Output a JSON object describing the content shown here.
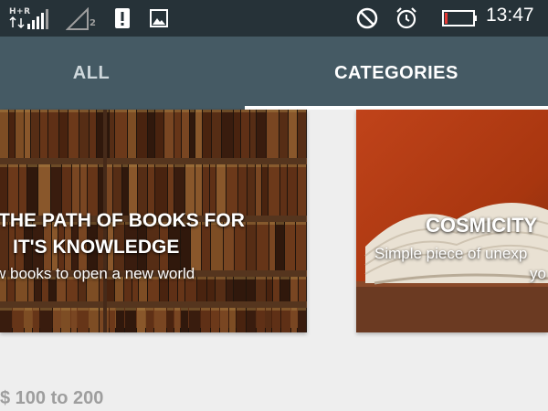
{
  "status_bar": {
    "network_label": "H+R",
    "sim_number": "2",
    "time": "13:47",
    "icons": [
      "signal-icon",
      "signal-empty-icon",
      "alert-icon",
      "image-icon",
      "do-not-disturb-icon",
      "alarm-icon",
      "battery-icon"
    ],
    "battery_level": 0.1,
    "battery_color": "#e53935"
  },
  "tabs": [
    {
      "label": "ALL",
      "selected": false
    },
    {
      "label": "CATEGORIES",
      "selected": true
    }
  ],
  "cards": [
    {
      "title_line_1": "THE PATH OF BOOKS FOR",
      "title_line_2": "IT'S KNOWLEDGE",
      "subtitle": "w books to open a new world"
    },
    {
      "title": "COSMICITY",
      "subtitle_line_1": "Simple piece of unexp",
      "subtitle_line_2": "yo"
    }
  ],
  "section": {
    "price_range": "$ 100 to 200"
  },
  "colors": {
    "status_bar": "#263238",
    "tab_bar": "#455a64",
    "background": "#eeeeee",
    "card_accent": "#c0431a"
  }
}
